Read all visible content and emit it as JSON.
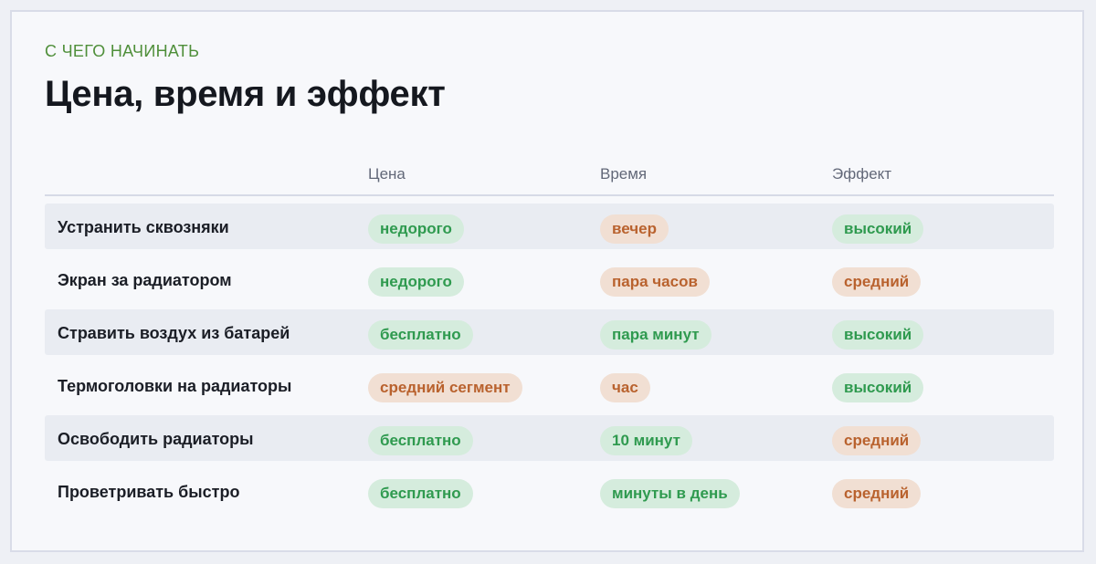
{
  "header": {
    "eyebrow": "С ЧЕГО НАЧИНАТЬ",
    "title": "Цена, время и эффект"
  },
  "table": {
    "columns": [
      "",
      "Цена",
      "Время",
      "Эффект"
    ],
    "rows": [
      {
        "name": "Устранить сквозняки",
        "price": {
          "text": "недорого",
          "tone": "good"
        },
        "time": {
          "text": "вечер",
          "tone": "mid"
        },
        "effect": {
          "text": "высокий",
          "tone": "good"
        }
      },
      {
        "name": "Экран за радиатором",
        "price": {
          "text": "недорого",
          "tone": "good"
        },
        "time": {
          "text": "пара часов",
          "tone": "mid"
        },
        "effect": {
          "text": "средний",
          "tone": "mid"
        }
      },
      {
        "name": "Стравить воздух из батарей",
        "price": {
          "text": "бесплатно",
          "tone": "good"
        },
        "time": {
          "text": "пара минут",
          "tone": "good"
        },
        "effect": {
          "text": "высокий",
          "tone": "good"
        }
      },
      {
        "name": "Термоголовки на радиаторы",
        "price": {
          "text": "средний сегмент",
          "tone": "mid"
        },
        "time": {
          "text": "час",
          "tone": "mid"
        },
        "effect": {
          "text": "высокий",
          "tone": "good"
        }
      },
      {
        "name": "Освободить радиаторы",
        "price": {
          "text": "бесплатно",
          "tone": "good"
        },
        "time": {
          "text": "10 минут",
          "tone": "good"
        },
        "effect": {
          "text": "средний",
          "tone": "mid"
        }
      },
      {
        "name": "Проветривать быстро",
        "price": {
          "text": "бесплатно",
          "tone": "good"
        },
        "time": {
          "text": "минуты в день",
          "tone": "good"
        },
        "effect": {
          "text": "средний",
          "tone": "mid"
        }
      }
    ]
  },
  "colors": {
    "accent": "#4f8f3a",
    "good_bg": "#d5ecdd",
    "good_text": "#2f9a4f",
    "mid_bg": "#f1dfd3",
    "mid_text": "#b9622e"
  }
}
